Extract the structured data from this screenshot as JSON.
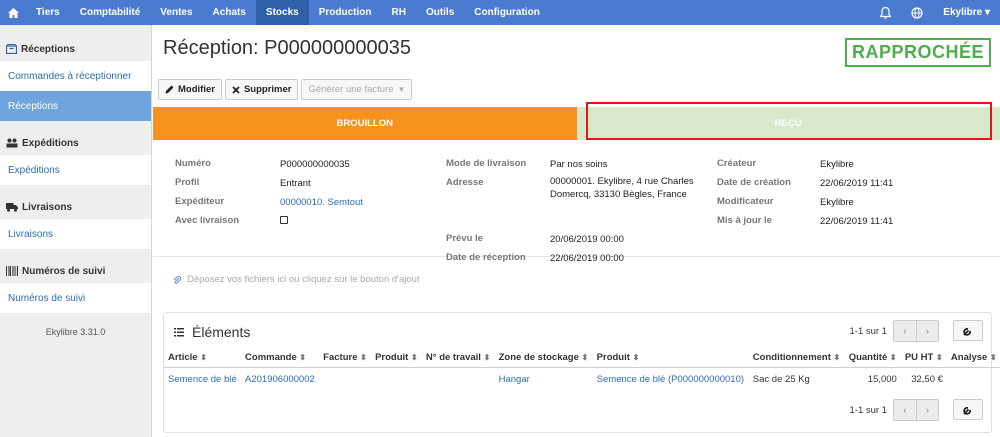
{
  "topnav": {
    "items": [
      "Tiers",
      "Comptabilité",
      "Ventes",
      "Achats",
      "Stocks",
      "Production",
      "RH",
      "Outils",
      "Configuration"
    ],
    "active_index": 4,
    "user": "Ekylibre ▾"
  },
  "sidebar": {
    "sections": [
      {
        "title": "Réceptions",
        "items": [
          "Commandes à réceptionner",
          "Réceptions"
        ]
      },
      {
        "title": "Expéditions",
        "items": [
          "Expéditions"
        ]
      },
      {
        "title": "Livraisons",
        "items": [
          "Livraisons"
        ]
      },
      {
        "title": "Numéros de suivi",
        "items": [
          "Numéros de suivi"
        ]
      }
    ],
    "version": "Ekylibre 3.31.0"
  },
  "page": {
    "title": "Réception: P000000000035",
    "status": "RAPPROCHÉE"
  },
  "toolbar": {
    "edit": "Modifier",
    "delete": "Supprimer",
    "invoice": "Générer une facture"
  },
  "steps": {
    "draft": "BROUILLON",
    "received": "REÇU"
  },
  "details": {
    "numero_label": "Numéro",
    "numero": "P000000000035",
    "profil_label": "Profil",
    "profil": "Entrant",
    "expediteur_label": "Expéditeur",
    "expediteur": "00000010. Semtout",
    "avec_livraison_label": "Avec livraison",
    "mode_label": "Mode de livraison",
    "mode": "Par nos soins",
    "adresse_label": "Adresse",
    "adresse": "00000001. Ekylibre, 4 rue Charles Domercq, 33130 Bègles, France",
    "prevu_label": "Prévu le",
    "prevu": "20/06/2019 00:00",
    "date_reception_label": "Date de réception",
    "date_reception": "22/06/2019 00:00",
    "createur_label": "Créateur",
    "createur": "Ekylibre",
    "date_creation_label": "Date de création",
    "date_creation": "22/06/2019 11:41",
    "modificateur_label": "Modificateur",
    "modificateur": "Ekylibre",
    "maj_label": "Mis à jour le",
    "maj": "22/06/2019 11:41"
  },
  "dropzone": "Déposez vos fichiers ici ou cliquez sur le bouton d'ajout",
  "items_panel": {
    "title": "Éléments",
    "pagination": "1-1 sur 1",
    "columns": [
      "Article",
      "Commande",
      "Facture",
      "Produit",
      "N° de travail",
      "Zone de stockage",
      "Produit",
      "Conditionnement",
      "Quantité",
      "PU HT",
      "Analyse"
    ],
    "rows": [
      [
        "Semence de blé",
        "A201906000002",
        "",
        "",
        "",
        "Hangar",
        "Semence de blé (P000000000010)",
        "Sac de 25 Kg",
        "15,000",
        "32,50 €",
        ""
      ]
    ]
  },
  "colors": {
    "nav": "#4a7bd0",
    "draft": "#f7921e",
    "received": "#d8e8c8",
    "status": "#4cae4c",
    "link": "#2d6cb3"
  }
}
